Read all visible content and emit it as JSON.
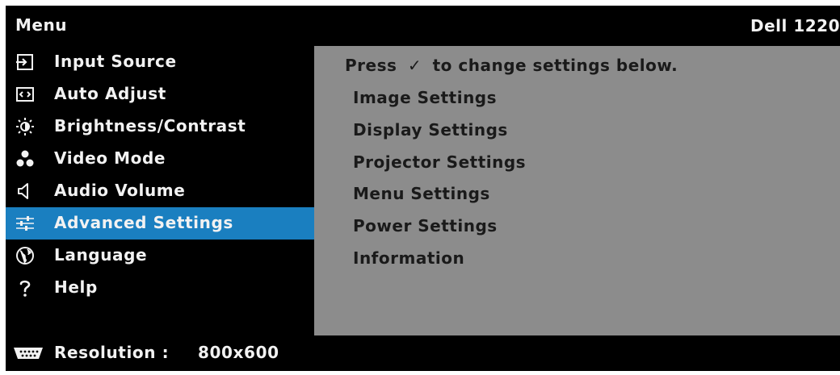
{
  "header": {
    "title": "Menu",
    "model": "Dell 1220"
  },
  "sidebar": {
    "items": [
      {
        "label": "Input Source",
        "icon": "input-source-icon"
      },
      {
        "label": "Auto Adjust",
        "icon": "auto-adjust-icon"
      },
      {
        "label": "Brightness/Contrast",
        "icon": "brightness-icon"
      },
      {
        "label": "Video Mode",
        "icon": "video-mode-icon"
      },
      {
        "label": "Audio Volume",
        "icon": "speaker-icon"
      },
      {
        "label": "Advanced Settings",
        "icon": "sliders-icon",
        "selected": true
      },
      {
        "label": "Language",
        "icon": "globe-icon"
      },
      {
        "label": "Help",
        "icon": "question-icon"
      }
    ]
  },
  "content": {
    "hint_before": "Press",
    "hint_check": "✓",
    "hint_after": "to change settings below.",
    "items": [
      "Image Settings",
      "Display Settings",
      "Projector Settings",
      "Menu Settings",
      "Power Settings",
      "Information"
    ]
  },
  "footer": {
    "resolution_label": "Resolution :",
    "resolution_value": "800x600",
    "icon": "vga-connector-icon"
  },
  "colors": {
    "selected": "#1a7fc0",
    "content_bg": "#8c8c8c",
    "background": "#000000"
  }
}
